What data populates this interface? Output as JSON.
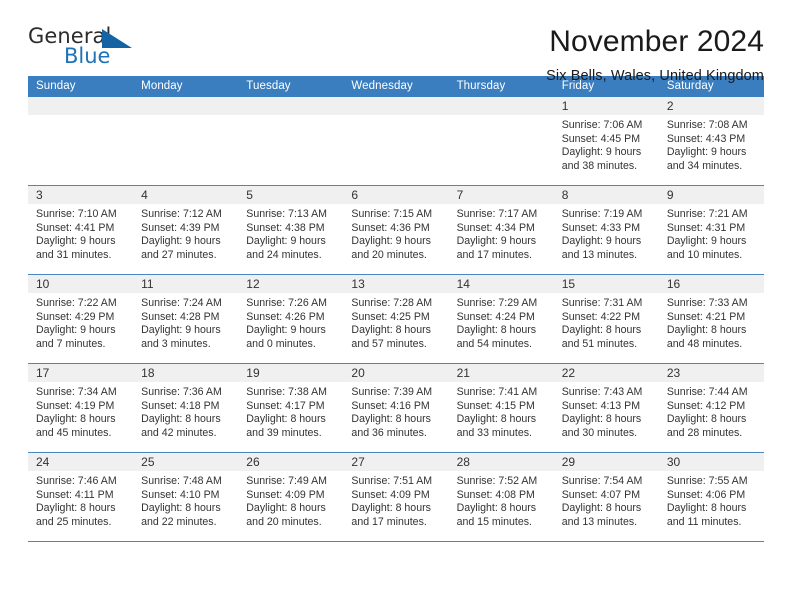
{
  "brand": {
    "name_part1": "General",
    "name_part2": "Blue"
  },
  "header": {
    "title": "November 2024",
    "subtitle": "Six Bells, Wales, United Kingdom"
  },
  "colors": {
    "header_blue": "#3a7ebf",
    "rule_blue": "#4a86c0",
    "daynum_bg": "#f0f0f0",
    "brand_blue": "#1d72b8",
    "text": "#333333"
  },
  "calendar": {
    "weekdays": [
      "Sunday",
      "Monday",
      "Tuesday",
      "Wednesday",
      "Thursday",
      "Friday",
      "Saturday"
    ],
    "weeks": [
      [
        {
          "day": "",
          "blank": true
        },
        {
          "day": "",
          "blank": true
        },
        {
          "day": "",
          "blank": true
        },
        {
          "day": "",
          "blank": true
        },
        {
          "day": "",
          "blank": true
        },
        {
          "day": "1",
          "sunrise": "Sunrise: 7:06 AM",
          "sunset": "Sunset: 4:45 PM",
          "daylight1": "Daylight: 9 hours",
          "daylight2": "and 38 minutes."
        },
        {
          "day": "2",
          "sunrise": "Sunrise: 7:08 AM",
          "sunset": "Sunset: 4:43 PM",
          "daylight1": "Daylight: 9 hours",
          "daylight2": "and 34 minutes."
        }
      ],
      [
        {
          "day": "3",
          "sunrise": "Sunrise: 7:10 AM",
          "sunset": "Sunset: 4:41 PM",
          "daylight1": "Daylight: 9 hours",
          "daylight2": "and 31 minutes."
        },
        {
          "day": "4",
          "sunrise": "Sunrise: 7:12 AM",
          "sunset": "Sunset: 4:39 PM",
          "daylight1": "Daylight: 9 hours",
          "daylight2": "and 27 minutes."
        },
        {
          "day": "5",
          "sunrise": "Sunrise: 7:13 AM",
          "sunset": "Sunset: 4:38 PM",
          "daylight1": "Daylight: 9 hours",
          "daylight2": "and 24 minutes."
        },
        {
          "day": "6",
          "sunrise": "Sunrise: 7:15 AM",
          "sunset": "Sunset: 4:36 PM",
          "daylight1": "Daylight: 9 hours",
          "daylight2": "and 20 minutes."
        },
        {
          "day": "7",
          "sunrise": "Sunrise: 7:17 AM",
          "sunset": "Sunset: 4:34 PM",
          "daylight1": "Daylight: 9 hours",
          "daylight2": "and 17 minutes."
        },
        {
          "day": "8",
          "sunrise": "Sunrise: 7:19 AM",
          "sunset": "Sunset: 4:33 PM",
          "daylight1": "Daylight: 9 hours",
          "daylight2": "and 13 minutes."
        },
        {
          "day": "9",
          "sunrise": "Sunrise: 7:21 AM",
          "sunset": "Sunset: 4:31 PM",
          "daylight1": "Daylight: 9 hours",
          "daylight2": "and 10 minutes."
        }
      ],
      [
        {
          "day": "10",
          "sunrise": "Sunrise: 7:22 AM",
          "sunset": "Sunset: 4:29 PM",
          "daylight1": "Daylight: 9 hours",
          "daylight2": "and 7 minutes."
        },
        {
          "day": "11",
          "sunrise": "Sunrise: 7:24 AM",
          "sunset": "Sunset: 4:28 PM",
          "daylight1": "Daylight: 9 hours",
          "daylight2": "and 3 minutes."
        },
        {
          "day": "12",
          "sunrise": "Sunrise: 7:26 AM",
          "sunset": "Sunset: 4:26 PM",
          "daylight1": "Daylight: 9 hours",
          "daylight2": "and 0 minutes."
        },
        {
          "day": "13",
          "sunrise": "Sunrise: 7:28 AM",
          "sunset": "Sunset: 4:25 PM",
          "daylight1": "Daylight: 8 hours",
          "daylight2": "and 57 minutes."
        },
        {
          "day": "14",
          "sunrise": "Sunrise: 7:29 AM",
          "sunset": "Sunset: 4:24 PM",
          "daylight1": "Daylight: 8 hours",
          "daylight2": "and 54 minutes."
        },
        {
          "day": "15",
          "sunrise": "Sunrise: 7:31 AM",
          "sunset": "Sunset: 4:22 PM",
          "daylight1": "Daylight: 8 hours",
          "daylight2": "and 51 minutes."
        },
        {
          "day": "16",
          "sunrise": "Sunrise: 7:33 AM",
          "sunset": "Sunset: 4:21 PM",
          "daylight1": "Daylight: 8 hours",
          "daylight2": "and 48 minutes."
        }
      ],
      [
        {
          "day": "17",
          "sunrise": "Sunrise: 7:34 AM",
          "sunset": "Sunset: 4:19 PM",
          "daylight1": "Daylight: 8 hours",
          "daylight2": "and 45 minutes."
        },
        {
          "day": "18",
          "sunrise": "Sunrise: 7:36 AM",
          "sunset": "Sunset: 4:18 PM",
          "daylight1": "Daylight: 8 hours",
          "daylight2": "and 42 minutes."
        },
        {
          "day": "19",
          "sunrise": "Sunrise: 7:38 AM",
          "sunset": "Sunset: 4:17 PM",
          "daylight1": "Daylight: 8 hours",
          "daylight2": "and 39 minutes."
        },
        {
          "day": "20",
          "sunrise": "Sunrise: 7:39 AM",
          "sunset": "Sunset: 4:16 PM",
          "daylight1": "Daylight: 8 hours",
          "daylight2": "and 36 minutes."
        },
        {
          "day": "21",
          "sunrise": "Sunrise: 7:41 AM",
          "sunset": "Sunset: 4:15 PM",
          "daylight1": "Daylight: 8 hours",
          "daylight2": "and 33 minutes."
        },
        {
          "day": "22",
          "sunrise": "Sunrise: 7:43 AM",
          "sunset": "Sunset: 4:13 PM",
          "daylight1": "Daylight: 8 hours",
          "daylight2": "and 30 minutes."
        },
        {
          "day": "23",
          "sunrise": "Sunrise: 7:44 AM",
          "sunset": "Sunset: 4:12 PM",
          "daylight1": "Daylight: 8 hours",
          "daylight2": "and 28 minutes."
        }
      ],
      [
        {
          "day": "24",
          "sunrise": "Sunrise: 7:46 AM",
          "sunset": "Sunset: 4:11 PM",
          "daylight1": "Daylight: 8 hours",
          "daylight2": "and 25 minutes."
        },
        {
          "day": "25",
          "sunrise": "Sunrise: 7:48 AM",
          "sunset": "Sunset: 4:10 PM",
          "daylight1": "Daylight: 8 hours",
          "daylight2": "and 22 minutes."
        },
        {
          "day": "26",
          "sunrise": "Sunrise: 7:49 AM",
          "sunset": "Sunset: 4:09 PM",
          "daylight1": "Daylight: 8 hours",
          "daylight2": "and 20 minutes."
        },
        {
          "day": "27",
          "sunrise": "Sunrise: 7:51 AM",
          "sunset": "Sunset: 4:09 PM",
          "daylight1": "Daylight: 8 hours",
          "daylight2": "and 17 minutes."
        },
        {
          "day": "28",
          "sunrise": "Sunrise: 7:52 AM",
          "sunset": "Sunset: 4:08 PM",
          "daylight1": "Daylight: 8 hours",
          "daylight2": "and 15 minutes."
        },
        {
          "day": "29",
          "sunrise": "Sunrise: 7:54 AM",
          "sunset": "Sunset: 4:07 PM",
          "daylight1": "Daylight: 8 hours",
          "daylight2": "and 13 minutes."
        },
        {
          "day": "30",
          "sunrise": "Sunrise: 7:55 AM",
          "sunset": "Sunset: 4:06 PM",
          "daylight1": "Daylight: 8 hours",
          "daylight2": "and 11 minutes."
        }
      ]
    ]
  }
}
